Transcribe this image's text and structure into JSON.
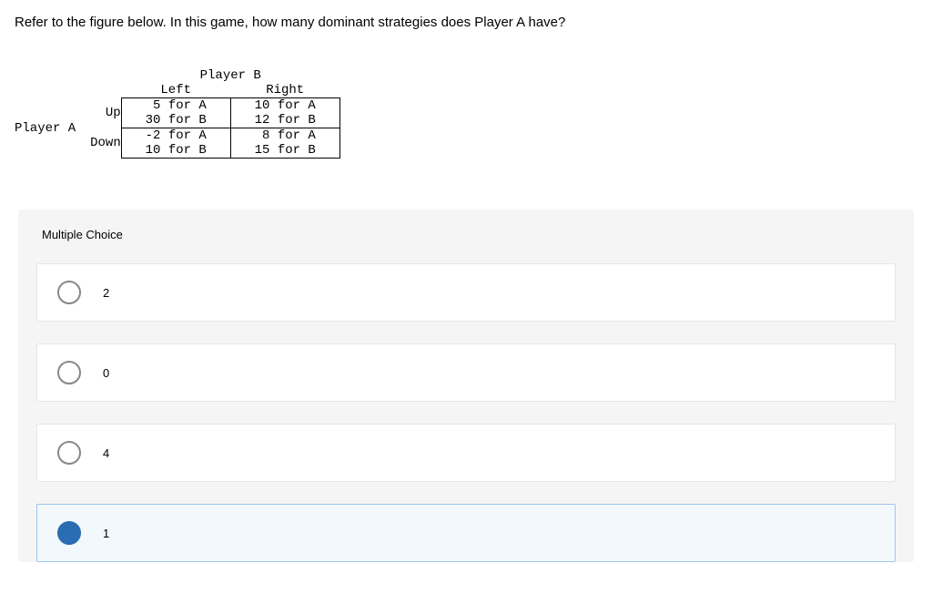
{
  "question": "Refer to the figure below. In this game, how many dominant strategies does Player A have?",
  "matrix": {
    "playerB": "Player B",
    "playerA": "Player A",
    "cols": [
      "Left",
      "Right"
    ],
    "rows": [
      "Up",
      "Down"
    ],
    "cells": {
      "up_left_a": " 5 for A",
      "up_left_b": "30 for B",
      "up_right_a": "10 for A",
      "up_right_b": "12 for B",
      "down_left_a": "-2 for A",
      "down_left_b": "10 for B",
      "down_right_a": " 8 for A",
      "down_right_b": "15 for B"
    }
  },
  "mc": {
    "title": "Multiple Choice",
    "options": [
      "2",
      "0",
      "4",
      "1"
    ],
    "selected_index": 3
  },
  "chart_data": {
    "type": "table",
    "title": "Payoff matrix — Player A rows (Up/Down), Player B columns (Left/Right)",
    "players": [
      "A",
      "B"
    ],
    "row_strategies": [
      "Up",
      "Down"
    ],
    "col_strategies": [
      "Left",
      "Right"
    ],
    "payoffs": {
      "Up": {
        "Left": {
          "A": 5,
          "B": 30
        },
        "Right": {
          "A": 10,
          "B": 12
        }
      },
      "Down": {
        "Left": {
          "A": -2,
          "B": 10
        },
        "Right": {
          "A": 8,
          "B": 15
        }
      }
    }
  }
}
